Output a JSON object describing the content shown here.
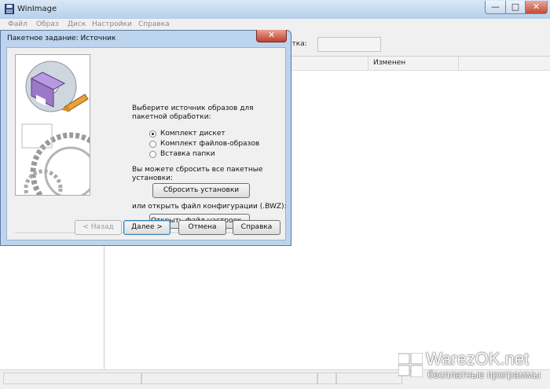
{
  "window": {
    "title": "WinImage",
    "controls": {
      "minimize": "—",
      "maximize": "□",
      "close": "✕"
    }
  },
  "menu": [
    {
      "label": "Файл"
    },
    {
      "label": "Образ"
    },
    {
      "label": "Диск"
    },
    {
      "label": "Настройки"
    },
    {
      "label": "Справка"
    }
  ],
  "toolbar": {
    "label_text": "етка:",
    "label_value": ""
  },
  "list": {
    "columns": [
      {
        "label": "п"
      },
      {
        "label": "Изменен"
      }
    ]
  },
  "watermark": {
    "title": "WarezOK.net",
    "subtitle": "бесплатные программы"
  },
  "dialog": {
    "title": "Пакетное задание: Источник",
    "close": "✕",
    "prompt": "Выберите источник образов для пакетной обработки:",
    "options": [
      {
        "label": "Комплект дискет",
        "selected": true
      },
      {
        "label": "Комплект файлов-образов",
        "selected": false
      },
      {
        "label": "Вставка папки",
        "selected": false
      }
    ],
    "reset_text": "Вы можете сбросить все пакетные установки:",
    "reset_button": "Сбросить установки",
    "config_text": "или открыть файл конфигурации (.BWZ):",
    "open_button": "Открыть файл настроек...",
    "buttons": {
      "back": "< Назад",
      "next": "Далее >",
      "cancel": "Отмена",
      "help": "Справка"
    }
  }
}
